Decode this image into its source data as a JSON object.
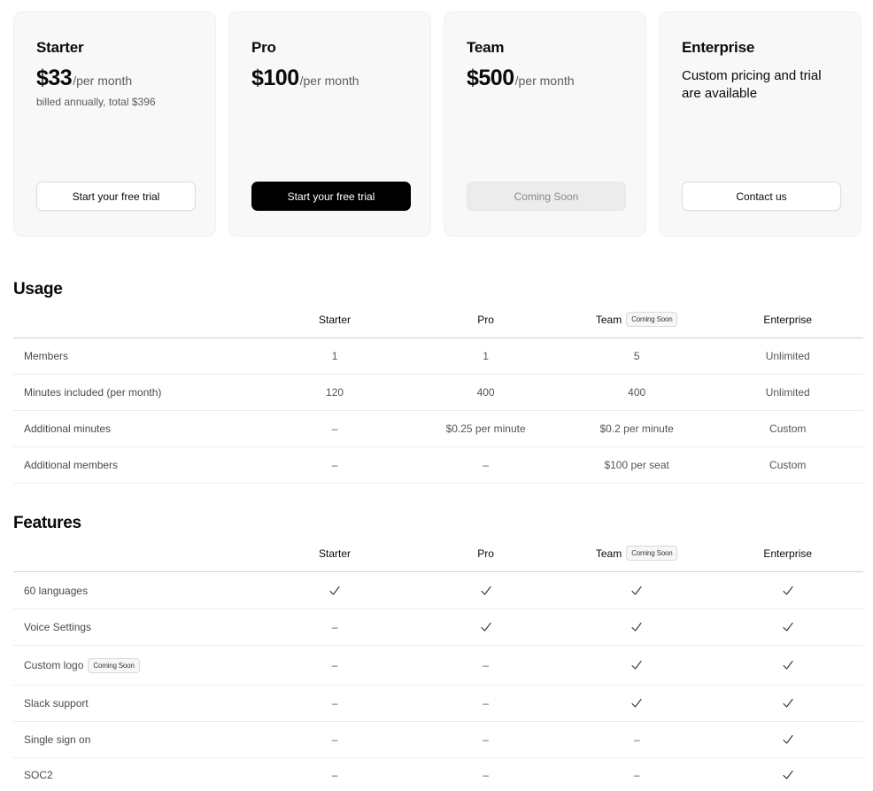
{
  "plans": [
    {
      "name": "Starter",
      "price": "$33",
      "period": "/per month",
      "sub": "billed annually, total $396",
      "desc": "",
      "button": "Start your free trial",
      "button_style": "outline"
    },
    {
      "name": "Pro",
      "price": "$100",
      "period": "/per month",
      "sub": "",
      "desc": "",
      "button": "Start your free trial",
      "button_style": "solid"
    },
    {
      "name": "Team",
      "price": "$500",
      "period": "/per month",
      "sub": "",
      "desc": "",
      "button": "Coming Soon",
      "button_style": "disabled"
    },
    {
      "name": "Enterprise",
      "price": "",
      "period": "",
      "sub": "",
      "desc": "Custom pricing and trial are available",
      "button": "Contact us",
      "button_style": "outline"
    }
  ],
  "usage": {
    "title": "Usage",
    "columns": [
      {
        "label": "Starter",
        "badge": ""
      },
      {
        "label": "Pro",
        "badge": ""
      },
      {
        "label": "Team",
        "badge": "Coming Soon"
      },
      {
        "label": "Enterprise",
        "badge": ""
      }
    ],
    "rows": [
      {
        "label": "Members",
        "badge": "",
        "values": [
          "1",
          "1",
          "5",
          "Unlimited"
        ]
      },
      {
        "label": "Minutes included (per month)",
        "badge": "",
        "values": [
          "120",
          "400",
          "400",
          "Unlimited"
        ]
      },
      {
        "label": "Additional minutes",
        "badge": "",
        "values": [
          "–",
          "$0.25 per minute",
          "$0.2 per minute",
          "Custom"
        ]
      },
      {
        "label": "Additional members",
        "badge": "",
        "values": [
          "–",
          "–",
          "$100 per seat",
          "Custom"
        ]
      }
    ]
  },
  "features": {
    "title": "Features",
    "columns": [
      {
        "label": "Starter",
        "badge": ""
      },
      {
        "label": "Pro",
        "badge": ""
      },
      {
        "label": "Team",
        "badge": "Coming Soon"
      },
      {
        "label": "Enterprise",
        "badge": ""
      }
    ],
    "rows": [
      {
        "label": "60 languages",
        "badge": "",
        "values": [
          "check",
          "check",
          "check",
          "check"
        ]
      },
      {
        "label": "Voice Settings",
        "badge": "",
        "values": [
          "–",
          "check",
          "check",
          "check"
        ]
      },
      {
        "label": "Custom logo",
        "badge": "Coming Soon",
        "values": [
          "–",
          "–",
          "check",
          "check"
        ]
      },
      {
        "label": "Slack support",
        "badge": "",
        "values": [
          "–",
          "–",
          "check",
          "check"
        ]
      },
      {
        "label": "Single sign on",
        "badge": "",
        "values": [
          "–",
          "–",
          "–",
          "check"
        ]
      },
      {
        "label": "SOC2",
        "badge": "",
        "values": [
          "–",
          "–",
          "–",
          "check"
        ]
      }
    ]
  },
  "icons": {
    "check": "check-icon"
  },
  "colors": {
    "primary_button": "#000000",
    "card_bg": "#f8f8f8",
    "disabled_button": "#ececec"
  }
}
